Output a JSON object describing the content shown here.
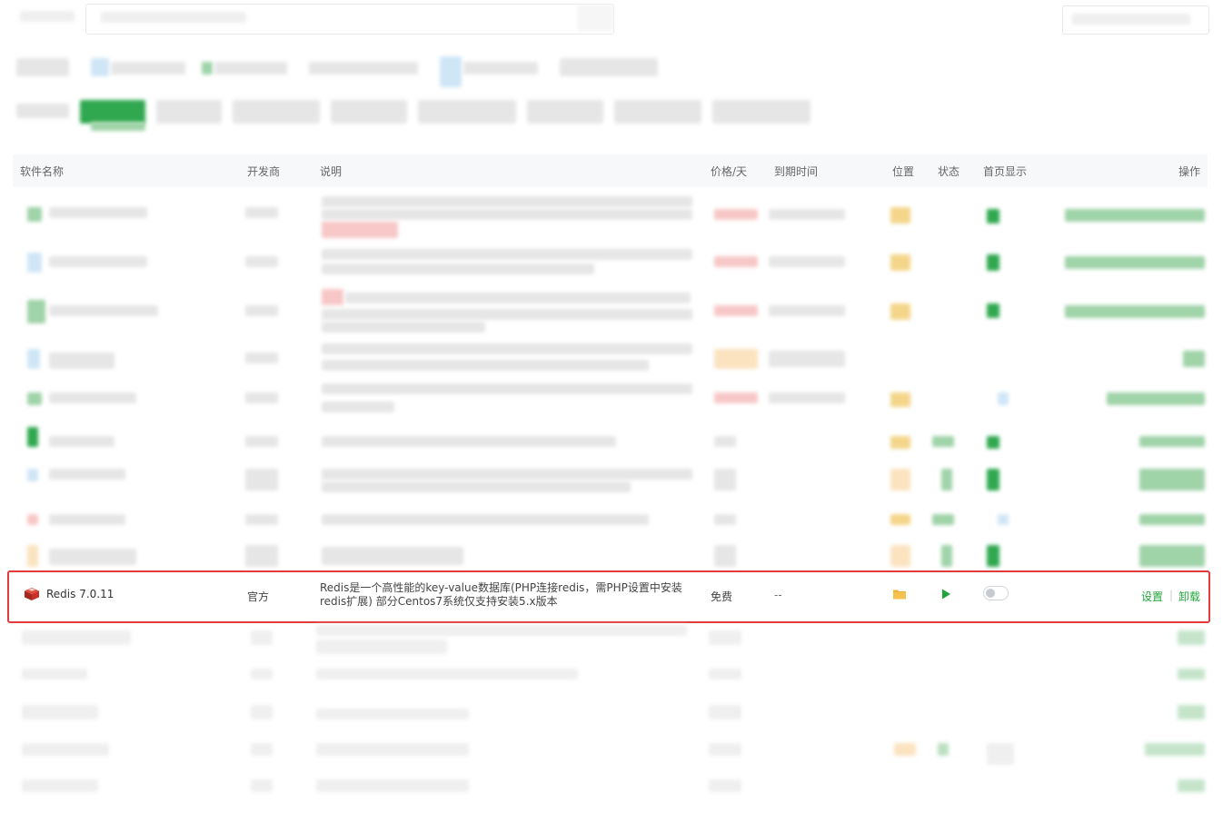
{
  "table": {
    "headers": {
      "name": "软件名称",
      "vendor": "开发商",
      "desc": "说明",
      "price": "价格/天",
      "expire": "到期时间",
      "location": "位置",
      "status": "状态",
      "home": "首页显示",
      "ops": "操作"
    },
    "highlighted_row": {
      "name": "Redis 7.0.11",
      "vendor": "官方",
      "desc": "Redis是一个高性能的key-value数据库(PHP连接redis，需PHP设置中安装redis扩展) 部分Centos7系统仅支持安装5.x版本",
      "price": "免费",
      "expire": "--",
      "home_display_on": false,
      "ops": {
        "settings": "设置",
        "separator": "|",
        "uninstall": "卸载"
      }
    }
  },
  "colors": {
    "accent_green": "#20a53a",
    "highlight_outline": "#e23b3b",
    "folder": "#f0b232",
    "play": "#20a53a",
    "redis_red": "#c9302c"
  },
  "icons": {
    "redis": "redis-cube-icon",
    "folder": "folder-icon",
    "play": "play-icon"
  }
}
